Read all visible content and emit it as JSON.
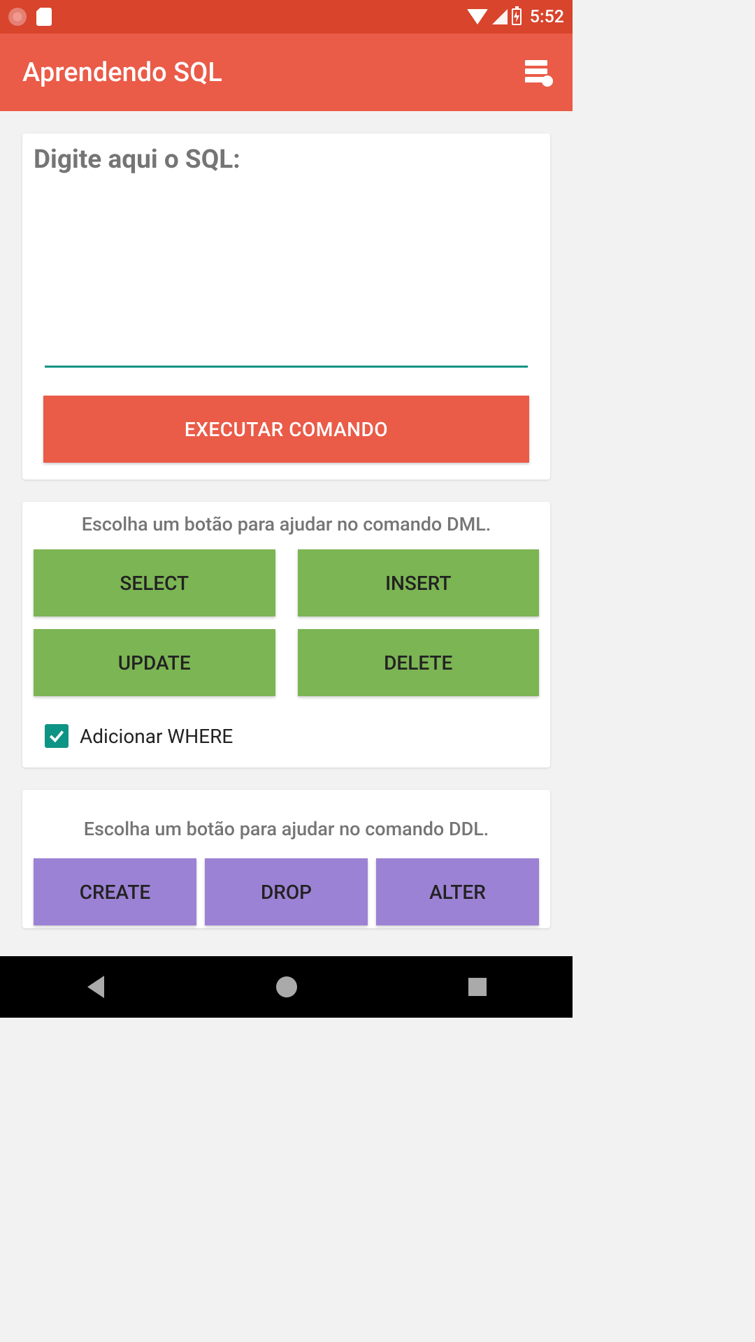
{
  "status": {
    "time": "5:52"
  },
  "appbar": {
    "title": "Aprendendo SQL"
  },
  "sql_card": {
    "label": "Digite aqui o SQL:",
    "input_value": "",
    "execute_label": "EXECUTAR COMANDO"
  },
  "dml_card": {
    "title": "Escolha um botão para ajudar no comando DML.",
    "buttons": {
      "select": "SELECT",
      "insert": "INSERT",
      "update": "UPDATE",
      "delete": "DELETE"
    },
    "where_label": "Adicionar WHERE",
    "where_checked": true
  },
  "ddl_card": {
    "title": "Escolha um botão para ajudar no comando DDL.",
    "buttons": {
      "create": "CREATE",
      "drop": "DROP",
      "alter": "ALTER"
    }
  },
  "colors": {
    "status_bar": "#d8442c",
    "app_bar": "#ea5b48",
    "teal": "#0e9484",
    "green": "#7cb553",
    "purple": "#9c82d4"
  }
}
